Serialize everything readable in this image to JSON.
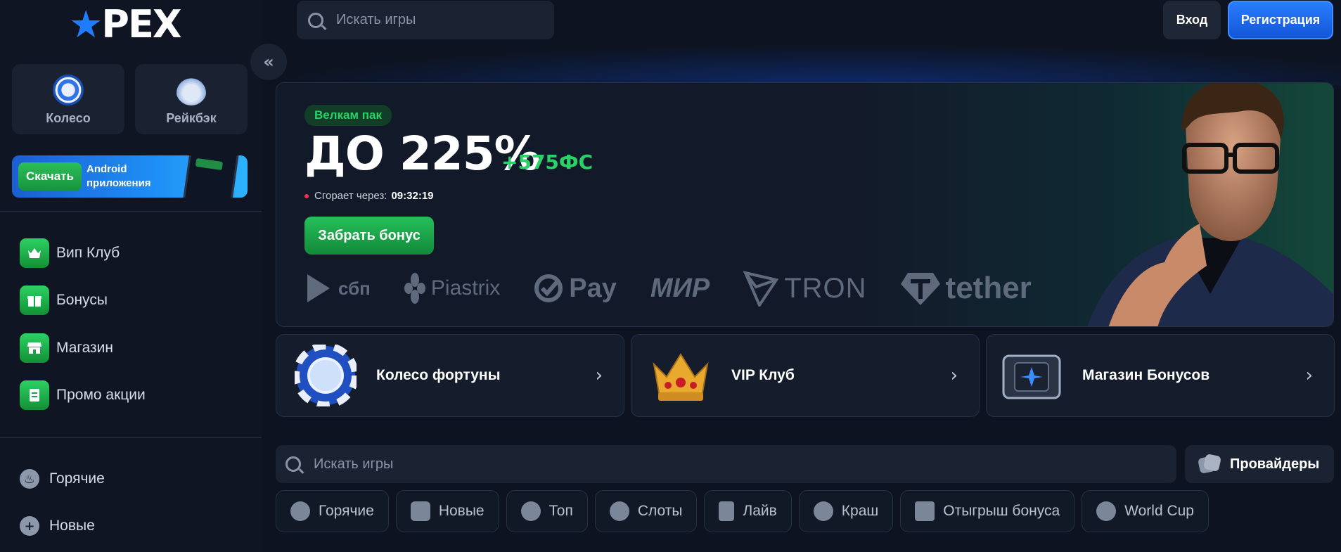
{
  "brand": {
    "logo_text_left": "",
    "logo_text_right": "PEX",
    "logo_star": "A"
  },
  "sidebar": {
    "quick_tiles": [
      {
        "label": "Колесо",
        "icon": "wheel-icon"
      },
      {
        "label": "Рейкбэк",
        "icon": "money-bag-icon"
      }
    ],
    "download": {
      "button": "Скачать",
      "text": "Android приложения"
    },
    "menu": [
      {
        "label": "Вип Клуб",
        "icon": "crown-icon"
      },
      {
        "label": "Бонусы",
        "icon": "gift-icon"
      },
      {
        "label": "Магазин",
        "icon": "shop-icon"
      },
      {
        "label": "Промо акции",
        "icon": "ticket-icon"
      }
    ],
    "categories": [
      {
        "label": "Горячие",
        "icon": "fire-icon"
      },
      {
        "label": "Новые",
        "icon": "plus-icon"
      }
    ]
  },
  "header": {
    "search_placeholder": "Искать игры",
    "login": "Вход",
    "register": "Регистрация"
  },
  "hero": {
    "badge": "Велкам пак",
    "title": "ДО 225%",
    "extra": "+575ФС",
    "timer_label": "Сгорает через:",
    "timer_value": "09:32:19",
    "button": "Забрать бонус",
    "payments": [
      "сбп",
      "Piastrix",
      "Pay",
      "МИР",
      "TRON",
      "tether"
    ]
  },
  "features": [
    {
      "label": "Колесо фортуны"
    },
    {
      "label": "VIP Клуб"
    },
    {
      "label": "Магазин Бонусов"
    }
  ],
  "games": {
    "search_placeholder": "Искать игры",
    "providers": "Провайдеры",
    "chips": [
      {
        "label": "Горячие",
        "icon": "fire-icon"
      },
      {
        "label": "Новые",
        "icon": "plus-icon"
      },
      {
        "label": "Топ",
        "icon": "medal-icon"
      },
      {
        "label": "Слоты",
        "icon": "cherry-icon"
      },
      {
        "label": "Лайв",
        "icon": "card-icon"
      },
      {
        "label": "Краш",
        "icon": "explosion-icon"
      },
      {
        "label": "Отыгрыш бонуса",
        "icon": "gift-icon"
      },
      {
        "label": "World Cup",
        "icon": "trophy-icon"
      }
    ]
  },
  "colors": {
    "accent_green": "#29d166",
    "accent_blue": "#1f7cff",
    "bg": "#0d1320"
  }
}
